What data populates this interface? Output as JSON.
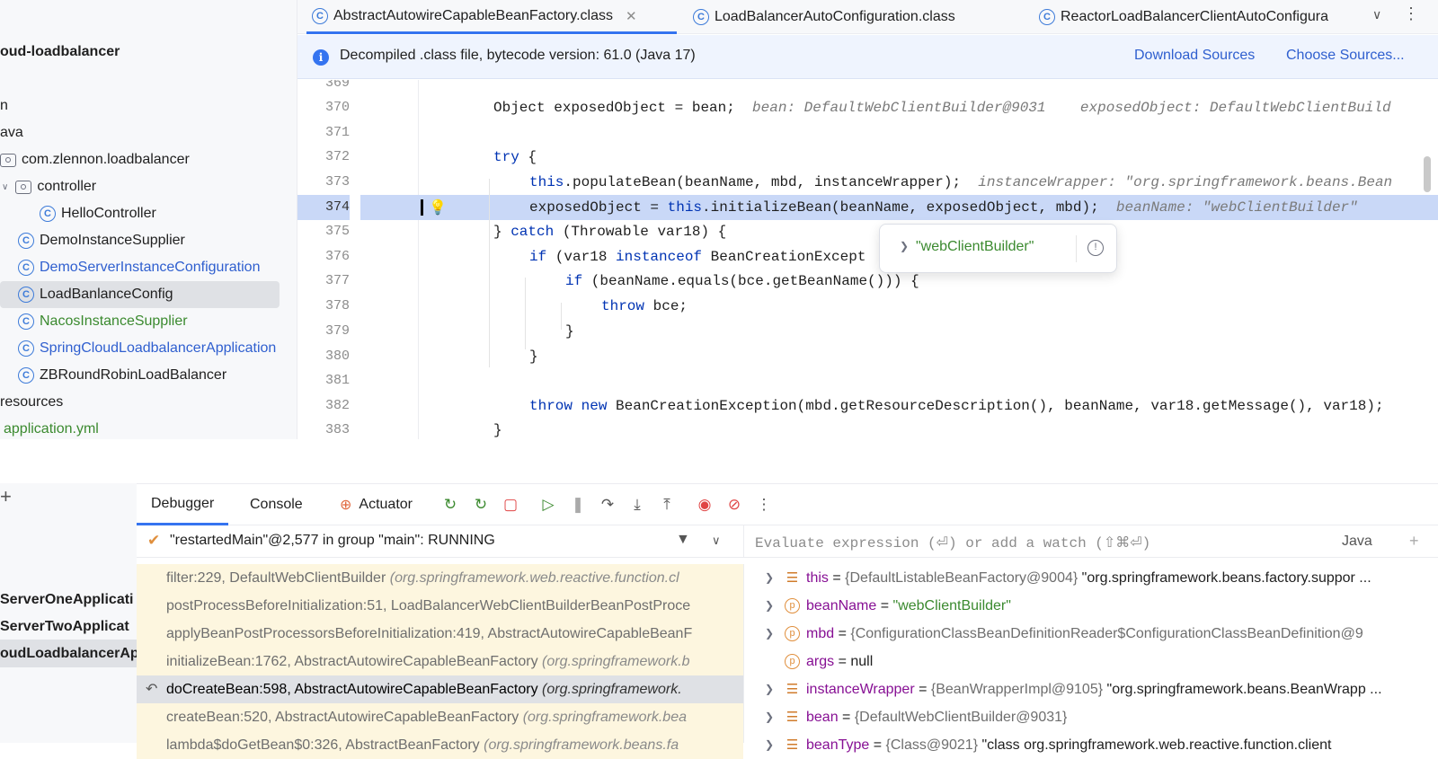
{
  "sidebar": {
    "project": "oud-loadbalancer",
    "items": [
      {
        "label": "n"
      },
      {
        "label": "ava"
      },
      {
        "label": "com.zlennon.loadbalancer"
      },
      {
        "label": "controller"
      },
      {
        "label": "HelloController"
      },
      {
        "label": "DemoInstanceSupplier"
      },
      {
        "label": "DemoServerInstanceConfiguration"
      },
      {
        "label": "LoadBanlanceConfig"
      },
      {
        "label": "NacosInstanceSupplier"
      },
      {
        "label": "SpringCloudLoadbalancerApplication"
      },
      {
        "label": "ZBRoundRobinLoadBalancer"
      },
      {
        "label": "resources"
      },
      {
        "label": "application.yml"
      }
    ]
  },
  "tabs": [
    {
      "label": "AbstractAutowireCapableBeanFactory.class"
    },
    {
      "label": "LoadBalancerAutoConfiguration.class"
    },
    {
      "label": "ReactorLoadBalancerClientAutoConfigura"
    }
  ],
  "banner": {
    "text": "Decompiled .class file, bytecode version: 61.0 (Java 17)",
    "download": "Download Sources",
    "choose": "Choose Sources..."
  },
  "editor": {
    "lines": [
      "369",
      "370",
      "371",
      "372",
      "373",
      "374",
      "375",
      "376",
      "377",
      "378",
      "379",
      "380",
      "381",
      "382",
      "383"
    ],
    "code": {
      "l370a": "Object exposedObject = bean;",
      "h370a": "bean: DefaultWebClientBuilder@9031",
      "h370b": "exposedObject: DefaultWebClientBuild",
      "l372kw": "try",
      "l372r": " {",
      "l373kw": "this",
      "l373r": ".populateBean(beanName, mbd, instanceWrapper);",
      "h373": "instanceWrapper: \"org.springframework.beans.Bean",
      "l374a": "exposedObject = ",
      "l374kw": "this",
      "l374r": ".initializeBean(beanName, exposedObject, mbd);",
      "h374": "beanName: \"webClientBuilder\"",
      "l375a": "} ",
      "l375kw": "catch",
      "l375r": " (Throwable var18) {",
      "l376kw": "if",
      "l376m": " (var18 ",
      "l376kw2": "instanceof",
      "l376r": " BeanCreationExcept",
      "l377kw": "if",
      "l377r": " (beanName.equals(bce.getBeanName())) {",
      "l378kw": "throw",
      "l378r": " bce;",
      "l379": "}",
      "l380": "}",
      "l382kw": "throw new",
      "l382r": " BeanCreationException(mbd.getResourceDescription(), beanName, var18.getMessage(), var18);",
      "l383": "}"
    },
    "popup_value": "\"webClientBuilder\""
  },
  "debug": {
    "tabs": {
      "debugger": "Debugger",
      "console": "Console",
      "actuator": "Actuator"
    },
    "thread": "\"restartedMain\"@2,577 in group \"main\": RUNNING",
    "eval_placeholder": "Evaluate expression (⏎) or add a watch (⇧⌘⏎)",
    "lang": "Java",
    "frames": [
      {
        "name": "filter:229, DefaultWebClientBuilder",
        "pkg": "(org.springframework.web.reactive.function.cl"
      },
      {
        "name": "postProcessBeforeInitialization:51, LoadBalancerWebClientBuilderBeanPostProce",
        "pkg": ""
      },
      {
        "name": "applyBeanPostProcessorsBeforeInitialization:419, AbstractAutowireCapableBeanF",
        "pkg": ""
      },
      {
        "name": "initializeBean:1762, AbstractAutowireCapableBeanFactory",
        "pkg": "(org.springframework.b"
      },
      {
        "name": "doCreateBean:598, AbstractAutowireCapableBeanFactory",
        "pkg": "(org.springframework."
      },
      {
        "name": "createBean:520, AbstractAutowireCapableBeanFactory",
        "pkg": "(org.springframework.bea"
      },
      {
        "name": "lambda$doGetBean$0:326, AbstractBeanFactory",
        "pkg": "(org.springframework.beans.fa"
      }
    ],
    "variables": [
      {
        "name": "this",
        "type": "{DefaultListableBeanFactory@9004}",
        "value": "\"org.springframework.beans.factory.suppor ..."
      },
      {
        "name": "beanName",
        "type": "",
        "value": "\"webClientBuilder\""
      },
      {
        "name": "mbd",
        "type": "{ConfigurationClassBeanDefinitionReader$ConfigurationClassBeanDefinition@9",
        "value": ""
      },
      {
        "name": "args",
        "type": "",
        "value": "null"
      },
      {
        "name": "instanceWrapper",
        "type": "{BeanWrapperImpl@9105}",
        "value": "\"org.springframework.beans.BeanWrapp ..."
      },
      {
        "name": "bean",
        "type": "{DefaultWebClientBuilder@9031}",
        "value": ""
      },
      {
        "name": "beanType",
        "type": "{Class@9021}",
        "value": "\"class org.springframework.web.reactive.function.client"
      }
    ],
    "processes": [
      "ServerOneApplicati",
      "ServerTwoApplicat",
      "oudLoadbalancerAp"
    ]
  }
}
